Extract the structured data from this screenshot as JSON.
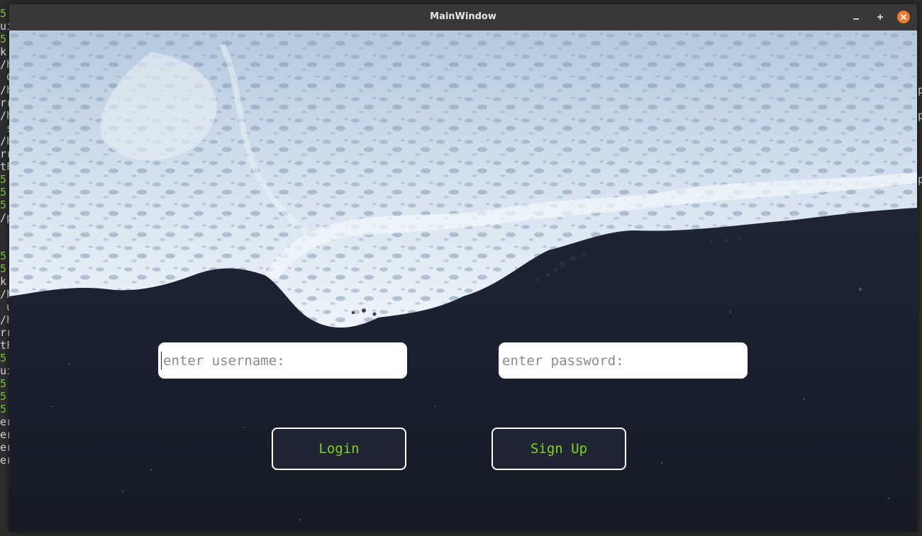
{
  "window": {
    "title": "MainWindow"
  },
  "titlebar_buttons": {
    "minimize_icon": "minimize-icon",
    "maximize_icon": "maximize-icon",
    "close_icon": "close-icon",
    "close_color": "#ee7b2f"
  },
  "form": {
    "username_placeholder": "enter username:",
    "username_value": "",
    "password_placeholder": "enter password:",
    "password_value": "",
    "login_label": "Login",
    "signup_label": "Sign Up",
    "button_text_color": "#7ed321"
  }
}
